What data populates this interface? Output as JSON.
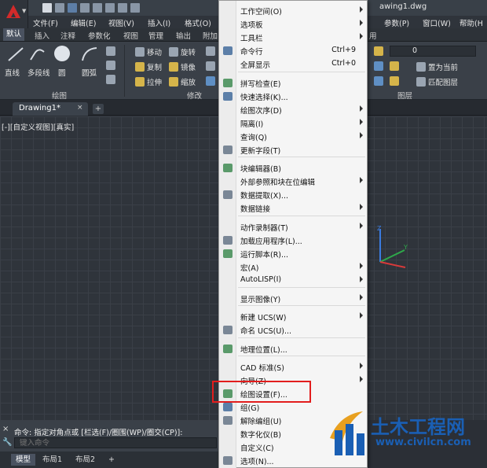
{
  "app": {
    "document_title": "awing1.dwg"
  },
  "menubar": {
    "items": [
      "文件(F)",
      "编辑(E)",
      "视图(V)",
      "插入(I)",
      "格式(O)",
      "参数(P)",
      "窗口(W)",
      "帮助(H"
    ]
  },
  "ribbon_tabs": {
    "items": [
      "默认",
      "插入",
      "注释",
      "参数化",
      "视图",
      "管理",
      "输出",
      "附加",
      "用"
    ],
    "active": "默认"
  },
  "ribbon": {
    "draw_panel": {
      "title": "绘图",
      "tools": [
        "直线",
        "多段线",
        "圆",
        "圆弧"
      ]
    },
    "modify_panel": {
      "title": "修改",
      "tools": [
        "移动",
        "旋转",
        "复制",
        "镜像",
        "拉伸",
        "缩放"
      ]
    },
    "layer_panel": {
      "title": "图层",
      "layer_value": "0",
      "tools": [
        "置为当前",
        "匹配图层"
      ]
    }
  },
  "doc_tabs": {
    "active": "Drawing1*",
    "close": "×",
    "new": "+"
  },
  "viewport": {
    "label": "[-][自定义视图][真实]"
  },
  "command_line": {
    "close": "×",
    "history": "命令: 指定对角点或 [栏选(F)/圈围(WP)/圈交(CP)]:",
    "placeholder": "键入命令"
  },
  "layout_tabs": {
    "items": [
      "模型",
      "布局1",
      "布局2"
    ],
    "active": "模型",
    "add": "+"
  },
  "tools_menu": {
    "items": [
      {
        "label": "工作空间(O)",
        "submenu": true
      },
      {
        "label": "选项板",
        "submenu": true
      },
      {
        "label": "工具栏",
        "submenu": true
      },
      {
        "label": "命令行",
        "shortcut": "Ctrl+9",
        "icon": "command-line-icon"
      },
      {
        "label": "全屏显示",
        "shortcut": "Ctrl+0"
      },
      {
        "label": "拼写检查(E)",
        "icon": "spell-check-icon"
      },
      {
        "label": "快速选择(K)...",
        "icon": "quick-select-icon"
      },
      {
        "label": "绘图次序(D)",
        "submenu": true
      },
      {
        "label": "隔离(I)",
        "submenu": true
      },
      {
        "label": "查询(Q)",
        "submenu": true
      },
      {
        "label": "更新字段(T)",
        "icon": "update-field-icon"
      },
      {
        "label": "块编辑器(B)",
        "icon": "block-editor-icon"
      },
      {
        "label": "外部参照和块在位编辑",
        "submenu": true
      },
      {
        "label": "数据提取(X)...",
        "icon": "data-extraction-icon"
      },
      {
        "label": "数据链接",
        "submenu": true
      },
      {
        "label": "动作录制器(T)",
        "submenu": true
      },
      {
        "label": "加载应用程序(L)...",
        "icon": "load-app-icon"
      },
      {
        "label": "运行脚本(R)...",
        "icon": "run-script-icon"
      },
      {
        "label": "宏(A)",
        "submenu": true
      },
      {
        "label": "AutoLISP(I)",
        "submenu": true
      },
      {
        "label": "显示图像(Y)",
        "submenu": true
      },
      {
        "label": "新建 UCS(W)",
        "submenu": true
      },
      {
        "label": "命名 UCS(U)...",
        "icon": "named-ucs-icon"
      },
      {
        "label": "地理位置(L)...",
        "icon": "geolocation-icon"
      },
      {
        "label": "CAD 标准(S)",
        "submenu": true
      },
      {
        "label": "向导(Z)",
        "submenu": true
      },
      {
        "label": "绘图设置(F)...",
        "icon": "drafting-settings-icon"
      },
      {
        "label": "组(G)",
        "icon": "group-icon"
      },
      {
        "label": "解除编组(U)",
        "icon": "ungroup-icon"
      },
      {
        "label": "数字化仪(B)"
      },
      {
        "label": "自定义(C)"
      },
      {
        "label": "选项(N)...",
        "icon": "options-check-icon"
      }
    ]
  },
  "watermark": {
    "title": "土木工程网",
    "url": "www.civilcn.com"
  },
  "colors": {
    "highlight_box": "#e21d1d",
    "watermark_blue": "#1a5fb4",
    "app_logo_red": "#d32a2a"
  }
}
